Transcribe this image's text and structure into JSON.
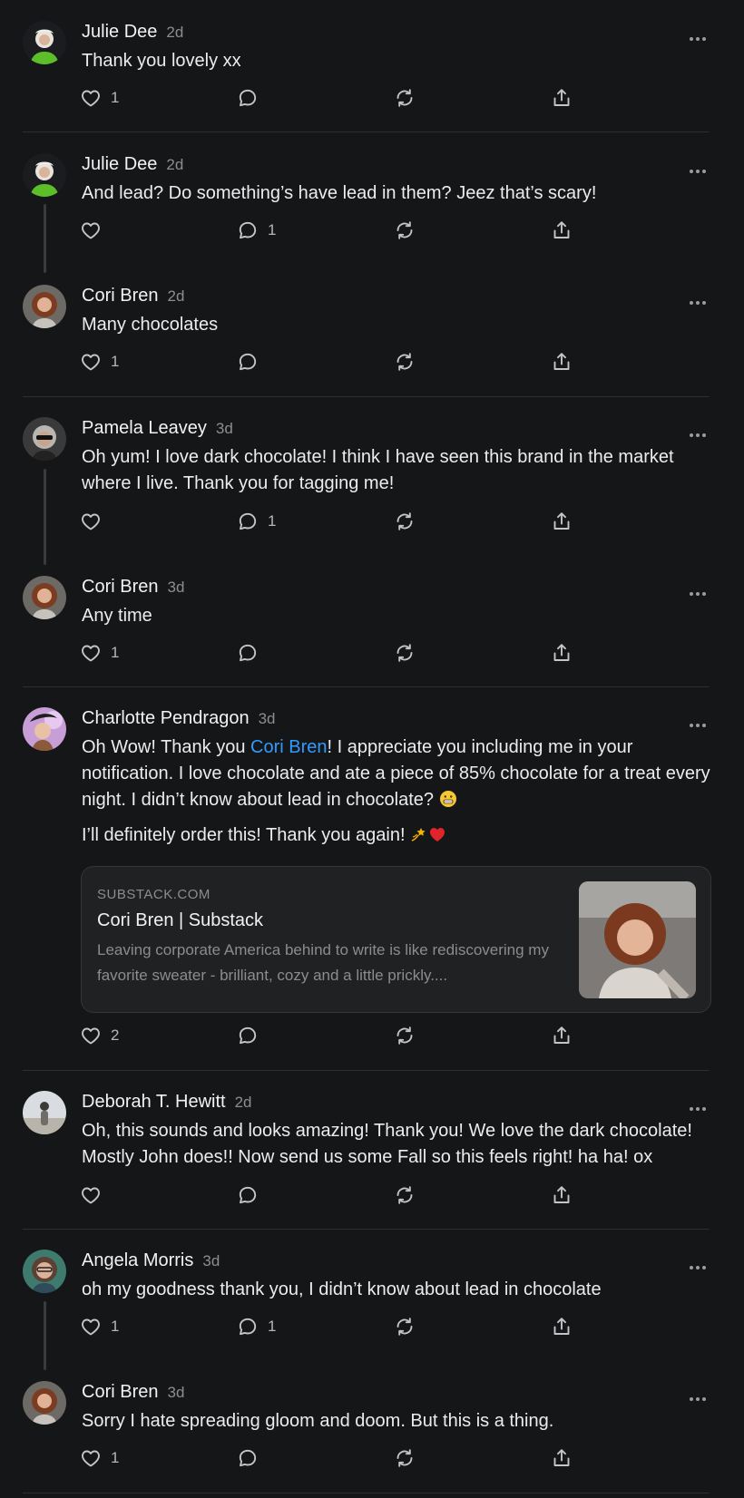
{
  "icons": {
    "like": "heart-icon",
    "reply": "speech-bubble-icon",
    "restack": "restack-icon",
    "share": "share-icon",
    "more": "more-dots-icon"
  },
  "colors": {
    "background": "#151618",
    "mention": "#2f9bff",
    "muted": "#8d8e91"
  },
  "comments": [
    {
      "name": "Julie Dee",
      "time": "2d",
      "text": "Thank you lovely xx",
      "likes": "1",
      "replies": ""
    },
    {
      "name": "Julie Dee",
      "time": "2d",
      "text": "And lead? Do something’s have lead in them? Jeez that’s scary!",
      "likes": "",
      "replies": "1"
    },
    {
      "name": "Cori Bren",
      "time": "2d",
      "text": "Many chocolates",
      "likes": "1",
      "replies": ""
    },
    {
      "name": "Pamela Leavey",
      "time": "3d",
      "text": "Oh yum! I love dark chocolate! I think I have seen this brand in the market where I live. Thank you for tagging me!",
      "likes": "",
      "replies": "1"
    },
    {
      "name": "Cori Bren",
      "time": "3d",
      "text": "Any time",
      "likes": "1",
      "replies": ""
    },
    {
      "name": "Charlotte Pendragon",
      "time": "3d",
      "text_before": "Oh Wow! Thank you ",
      "mention": "Cori Bren",
      "text_after": "! I appreciate you including me in your notification. I love chocolate and ate a piece of 85% chocolate for a treat every night. I didn’t know about lead in chocolate? ",
      "text2": "I’ll definitely order this! Thank you again! ",
      "likes": "2",
      "replies": "",
      "link_card": {
        "domain": "SUBSTACK.COM",
        "title": "Cori Bren | Substack",
        "description": "Leaving corporate America behind to write is like rediscovering my favorite sweater - brilliant, cozy and a little prickly...."
      }
    },
    {
      "name": "Deborah T. Hewitt",
      "time": "2d",
      "text": "Oh, this sounds and looks amazing! Thank you! We love the dark chocolate! Mostly John does!! Now send us some Fall so this feels right! ha ha! ox",
      "likes": "",
      "replies": ""
    },
    {
      "name": "Angela Morris",
      "time": "3d",
      "text": "oh my goodness thank you, I didn’t know about lead in chocolate",
      "likes": "1",
      "replies": "1"
    },
    {
      "name": "Cori Bren",
      "time": "3d",
      "text": "Sorry I hate spreading gloom and doom. But this is a thing.",
      "likes": "1",
      "replies": ""
    }
  ]
}
